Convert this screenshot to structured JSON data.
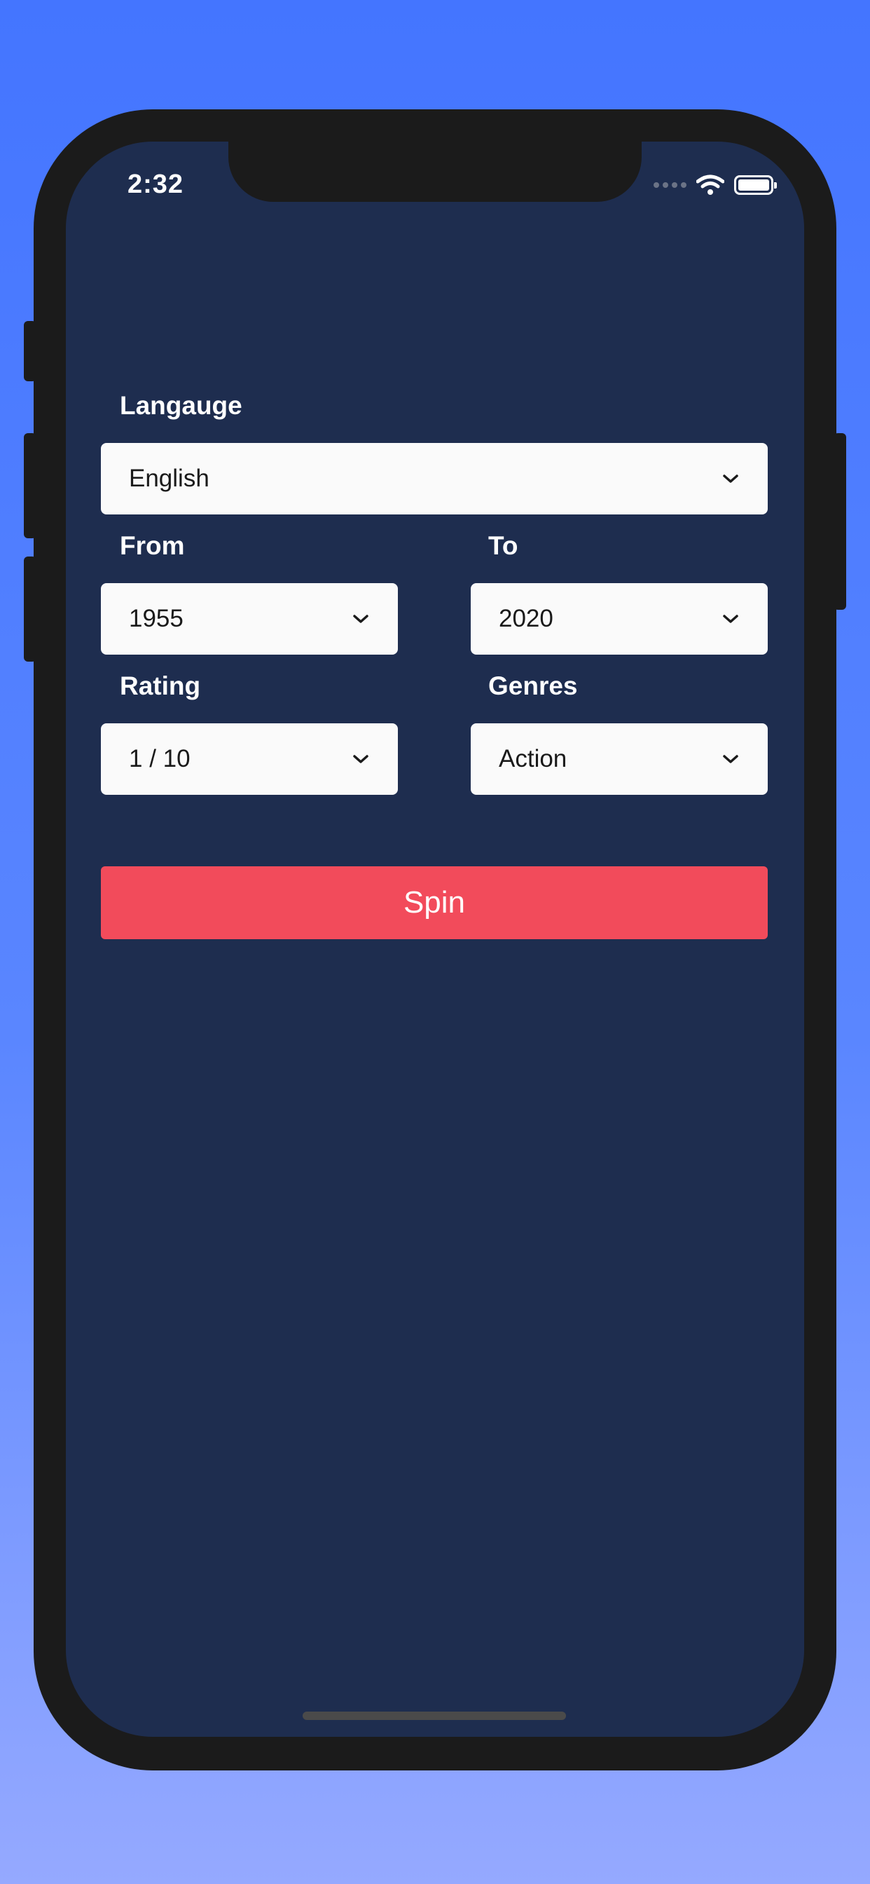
{
  "status_bar": {
    "time": "2:32",
    "icons": [
      "cellular-signal-icon",
      "wifi-icon",
      "battery-icon"
    ]
  },
  "form": {
    "language": {
      "label": "Langauge",
      "value": "English"
    },
    "from": {
      "label": "From",
      "value": "1955"
    },
    "to": {
      "label": "To",
      "value": "2020"
    },
    "rating": {
      "label": "Rating",
      "value": "1 / 10"
    },
    "genres": {
      "label": "Genres",
      "value": "Action"
    }
  },
  "spin_button": {
    "label": "Spin"
  },
  "colors": {
    "background_top": "#4475ff",
    "background_bottom": "#95a9ff",
    "device_frame": "#1b1b1b",
    "screen_background": "#1e2d4f",
    "select_background": "#fafafa",
    "spin_button": "#f24b5b"
  }
}
